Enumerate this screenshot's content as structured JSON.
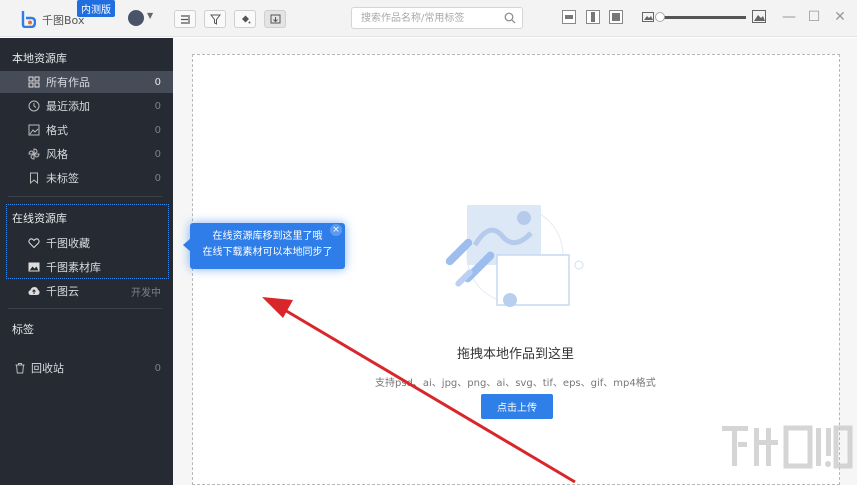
{
  "titlebar": {
    "app_name": "千图Box",
    "beta_badge": "内测版",
    "search_placeholder": "搜索作品名称/常用标签"
  },
  "sidebar": {
    "local_title": "本地资源库",
    "local_items": [
      {
        "label": "所有作品",
        "count": "0",
        "icon": "grid-icon",
        "selected": true
      },
      {
        "label": "最近添加",
        "count": "0",
        "icon": "clock-icon"
      },
      {
        "label": "格式",
        "count": "0",
        "icon": "image-format-icon"
      },
      {
        "label": "风格",
        "count": "0",
        "icon": "pinwheel-icon"
      },
      {
        "label": "未标签",
        "count": "0",
        "icon": "bookmark-icon"
      }
    ],
    "online_title": "在线资源库",
    "online_items": [
      {
        "label": "千图收藏",
        "icon": "heart-icon"
      },
      {
        "label": "千图素材库",
        "icon": "picture-icon"
      }
    ],
    "cloud_item": {
      "label": "千图云",
      "status": "开发中",
      "icon": "cloud-upload-icon"
    },
    "tags_title": "标签",
    "trash_item": {
      "label": "回收站",
      "count": "0",
      "icon": "trash-icon"
    }
  },
  "tooltip": {
    "line1": "在线资源库移到这里了哦",
    "line2": "在线下载素材可以本地同步了",
    "close": "×"
  },
  "main": {
    "drop_title": "拖拽本地作品到这里",
    "formats": "支持psd、ai、jpg、png、ai、svg、tif、eps、gif、mp4格式",
    "upload_button": "点击上传"
  },
  "colors": {
    "accent": "#2e7fe8",
    "sidebar_bg": "#262b33",
    "sidebar_selected": "#464c57",
    "annotation_arrow": "#d9262a"
  }
}
